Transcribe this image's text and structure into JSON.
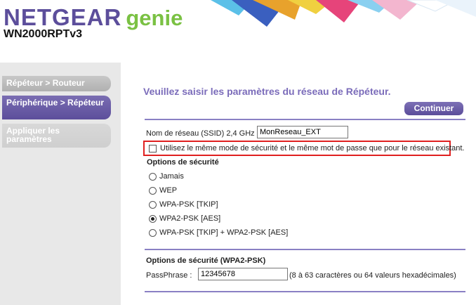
{
  "header": {
    "brand_name": "NETGEAR",
    "brand_sub": "genie",
    "model": "WN2000RPTv3"
  },
  "sidebar": {
    "items": [
      {
        "label": "Répéteur > Routeur",
        "state": "inactive"
      },
      {
        "label": "Périphérique > Répéteur",
        "state": "active"
      },
      {
        "label": "Appliquer les paramètres",
        "state": "disabled"
      }
    ]
  },
  "main": {
    "title": "Veuillez saisir les paramètres du réseau de Répéteur.",
    "continue_label": "Continuer",
    "ssid": {
      "label": "Nom de réseau (SSID) 2,4 GHz :",
      "value": "MonReseau_EXT"
    },
    "same_security": {
      "label": "Utilisez le même mode de sécurité et le même mot de passe que pour le réseau existant.",
      "checked": false
    },
    "security_options": {
      "title": "Options de sécurité",
      "options": [
        {
          "label": "Jamais",
          "selected": false
        },
        {
          "label": "WEP",
          "selected": false
        },
        {
          "label": "WPA-PSK [TKIP]",
          "selected": false
        },
        {
          "label": "WPA2-PSK [AES]",
          "selected": true
        },
        {
          "label": "WPA-PSK [TKIP] + WPA2-PSK [AES]",
          "selected": false
        }
      ]
    },
    "wpa2": {
      "title": "Options de sécurité (WPA2-PSK)",
      "passphrase_label": "PassPhrase :",
      "passphrase_value": "12345678",
      "hint": "(8 à 63 caractères ou 64 valeurs hexadécimales)"
    }
  },
  "colors": {
    "brand_purple": "#5c4e9b",
    "brand_green": "#7ac143",
    "title_purple": "#7b6cba",
    "highlight_red": "#e02020"
  }
}
